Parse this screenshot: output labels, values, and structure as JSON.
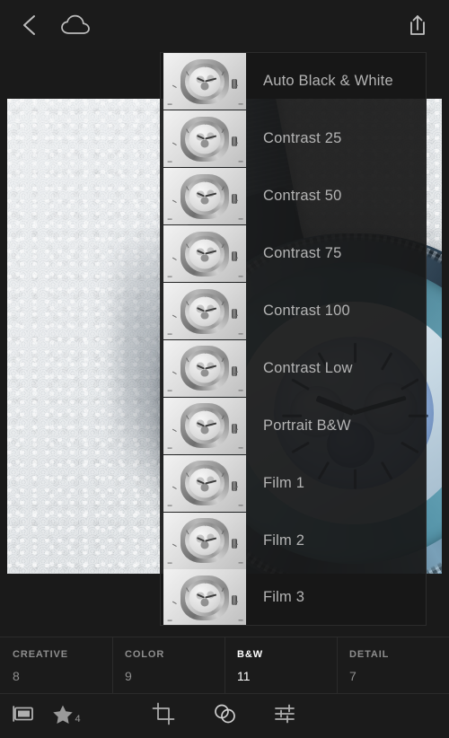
{
  "topbar": {
    "back_icon": "chevron-left-icon",
    "cloud_icon": "cloud-icon",
    "share_icon": "share-export-icon"
  },
  "photo": {
    "subject": "blue chronograph wristwatch on white textured surface"
  },
  "preset_panel": {
    "items": [
      {
        "label": "Auto Black & White"
      },
      {
        "label": "Contrast 25"
      },
      {
        "label": "Contrast 50"
      },
      {
        "label": "Contrast 75"
      },
      {
        "label": "Contrast 100"
      },
      {
        "label": "Contrast Low"
      },
      {
        "label": "Portrait B&W"
      },
      {
        "label": "Film 1"
      },
      {
        "label": "Film 2"
      },
      {
        "label": "Film 3"
      }
    ]
  },
  "categories": [
    {
      "name": "CREATIVE",
      "count": "8",
      "active": false
    },
    {
      "name": "COLOR",
      "count": "9",
      "active": false
    },
    {
      "name": "B&W",
      "count": "11",
      "active": true
    },
    {
      "name": "DETAIL",
      "count": "7",
      "active": false
    }
  ],
  "toolbar": {
    "filmstrip_icon": "filmstrip-icon",
    "star_icon": "star-icon",
    "star_count": "4",
    "crop_icon": "crop-icon",
    "presets_icon": "presets-circles-icon",
    "edit_icon": "sliders-icon"
  },
  "colors": {
    "background": "#1a1a1a",
    "panel": "#181818",
    "label_inactive": "#8e8e8e",
    "label_active": "#ffffff",
    "preset_text": "#b4b4b4"
  }
}
